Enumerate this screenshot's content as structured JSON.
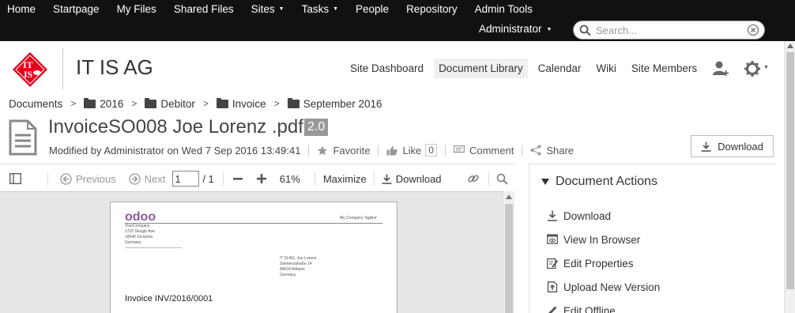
{
  "topnav": {
    "items": [
      {
        "label": "Home",
        "dropdown": false
      },
      {
        "label": "Startpage",
        "dropdown": false
      },
      {
        "label": "My Files",
        "dropdown": false
      },
      {
        "label": "Shared Files",
        "dropdown": false
      },
      {
        "label": "Sites",
        "dropdown": true
      },
      {
        "label": "Tasks",
        "dropdown": true
      },
      {
        "label": "People",
        "dropdown": false
      },
      {
        "label": "Repository",
        "dropdown": false
      },
      {
        "label": "Admin Tools",
        "dropdown": false
      }
    ],
    "user": "Administrator",
    "search_placeholder": "Search..."
  },
  "site": {
    "logo_text": "IT IS AG",
    "title": "IT IS AG",
    "nav": [
      {
        "label": "Site Dashboard",
        "active": false
      },
      {
        "label": "Document Library",
        "active": true
      },
      {
        "label": "Calendar",
        "active": false
      },
      {
        "label": "Wiki",
        "active": false
      },
      {
        "label": "Site Members",
        "active": false
      }
    ]
  },
  "breadcrumb": {
    "root": "Documents",
    "folders": [
      "2016",
      "Debitor",
      "Invoice",
      "September 2016"
    ]
  },
  "document": {
    "title": "InvoiceSO008 Joe Lorenz .pdf",
    "version": "2.0",
    "modified": "Modified by Administrator on Wed 7 Sep 2016 13:49:41",
    "favorite_label": "Favorite",
    "like_label": "Like",
    "like_count": "0",
    "comment_label": "Comment",
    "share_label": "Share",
    "download_label": "Download"
  },
  "viewer": {
    "previous_label": "Previous",
    "next_label": "Next",
    "page_value": "1",
    "page_total": "/ 1",
    "zoom": "61%",
    "maximize_label": "Maximize",
    "download_label": "Download"
  },
  "pdf": {
    "logo": "odoo",
    "tagline": "My Company Tagline",
    "sender": [
      "YourCompany",
      "1725 Slough Ave.",
      "18540 Scranton",
      "Germany"
    ],
    "recipient": [
      "IT IS AG, Joe Lorenz",
      "Siemensstraße 14",
      "84034 Altheim",
      "Germany"
    ],
    "invoice_title": "Invoice INV/2016/0001"
  },
  "panel": {
    "title": "Document Actions",
    "actions": [
      {
        "label": "Download",
        "icon": "download-icon"
      },
      {
        "label": "View In Browser",
        "icon": "view-in-browser-icon"
      },
      {
        "label": "Edit Properties",
        "icon": "edit-properties-icon"
      },
      {
        "label": "Upload New Version",
        "icon": "upload-icon"
      },
      {
        "label": "Edit Offline",
        "icon": "edit-offline-icon"
      }
    ]
  },
  "colors": {
    "topbar": "#111111",
    "logo_red": "#e3001b",
    "odoo_purple": "#8d5a9e",
    "version_badge": "#999999"
  }
}
